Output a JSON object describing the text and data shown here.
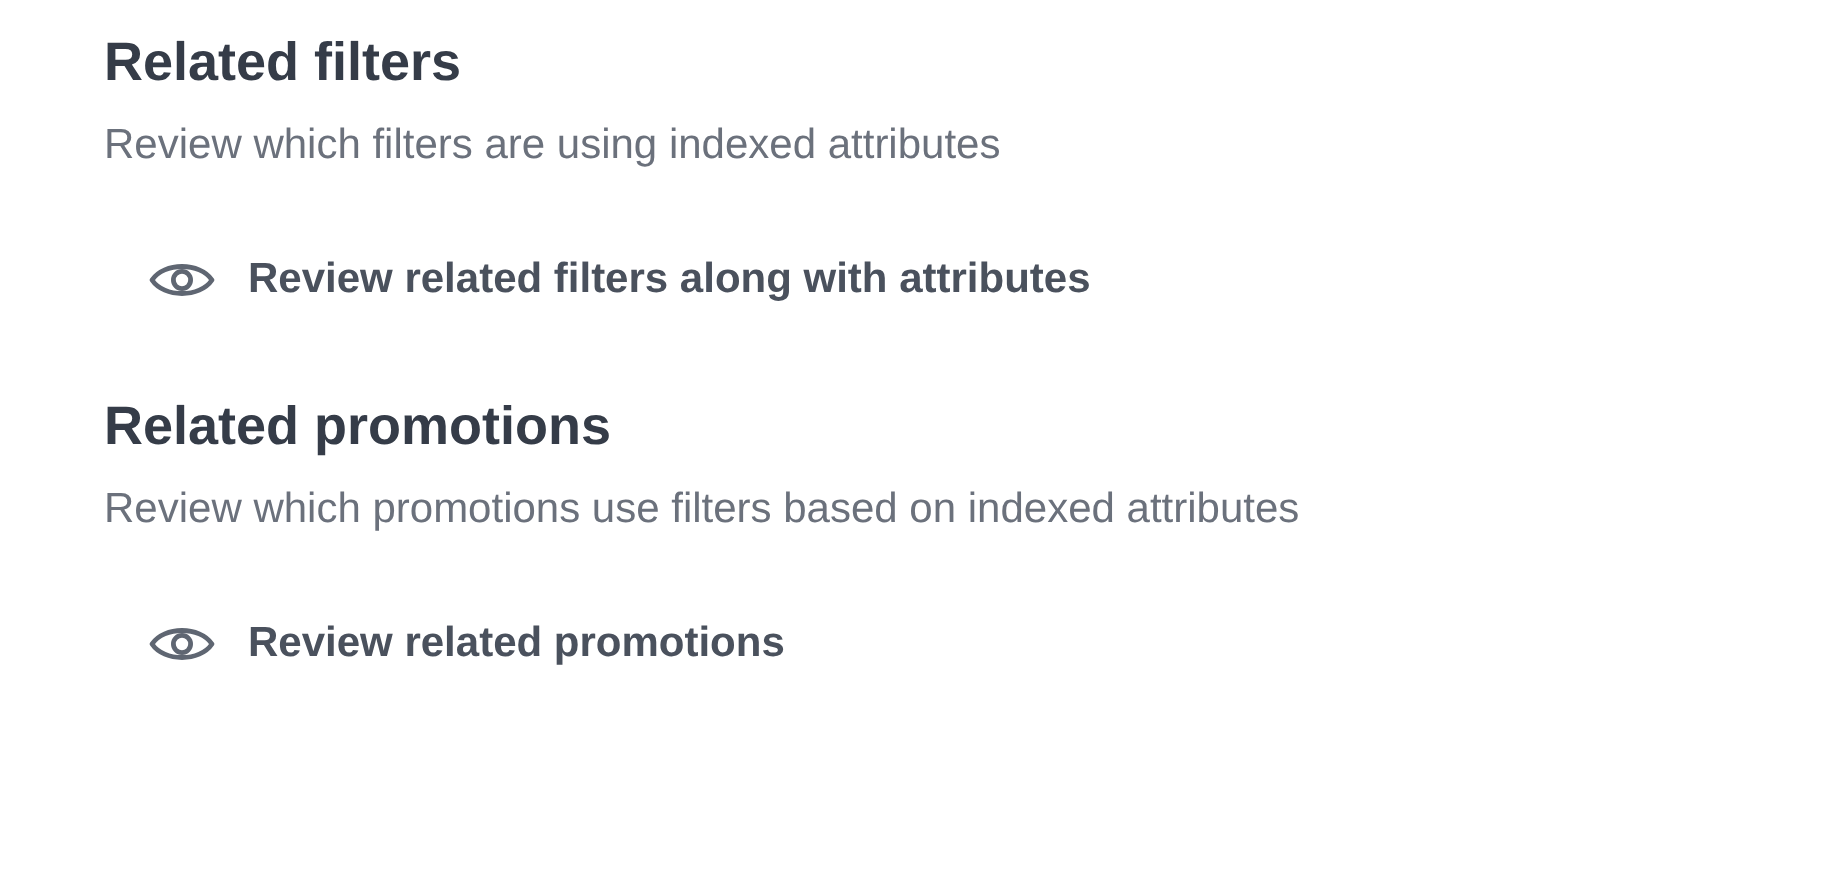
{
  "sections": [
    {
      "title": "Related filters",
      "description": "Review which filters are using indexed attributes",
      "action": "Review related filters along with attributes"
    },
    {
      "title": "Related promotions",
      "description": "Review which promotions use filters based on indexed attributes",
      "action": "Review related promotions"
    }
  ]
}
